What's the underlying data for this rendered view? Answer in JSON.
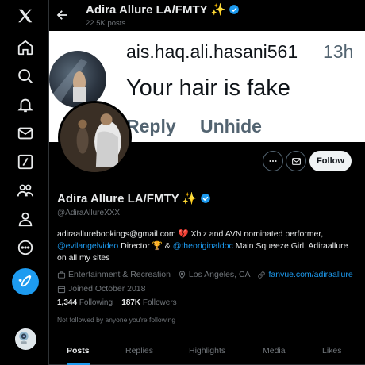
{
  "app": {
    "logo": "x-logo"
  },
  "nav": {
    "items": [
      {
        "name": "home",
        "icon": "home-icon"
      },
      {
        "name": "explore",
        "icon": "search-icon"
      },
      {
        "name": "notifications",
        "icon": "bell-icon"
      },
      {
        "name": "messages",
        "icon": "mail-icon"
      },
      {
        "name": "grok",
        "icon": "slash-box-icon"
      },
      {
        "name": "communities",
        "icon": "people-icon"
      },
      {
        "name": "profile",
        "icon": "person-icon"
      },
      {
        "name": "more",
        "icon": "more-circle-icon"
      }
    ],
    "compose_icon": "feather-plus-icon"
  },
  "header": {
    "name": "Adira Allure LA/FMTY",
    "emoji": "✨",
    "posts": "22.5K posts"
  },
  "banner": {
    "username": "ais.haq.ali.hasani561",
    "time": "13h",
    "text": "Your hair is fake",
    "reply": "Reply",
    "unhide": "Unhide"
  },
  "profile": {
    "name": "Adira Allure LA/FMTY",
    "emoji": "✨",
    "handle": "@AdiraAllureXXX",
    "bio_1": "adiraallurebookings@gmail.com",
    "bio_heart": "💔",
    "bio_2": " Xbiz and AVN nominated performer,",
    "bio_link1": "@evilangelvideo",
    "bio_3": " Director ",
    "bio_trophy": "🏆",
    "bio_4": " & ",
    "bio_link2": "@theoriginaldoc",
    "bio_5": " Main Squeeze Girl. Adiraallure on all my sites",
    "category": "Entertainment & Recreation",
    "location": "Los Angeles, CA",
    "website": "fanvue.com/adiraallure",
    "joined": "Joined October 2018",
    "following_count": "1,344",
    "following_label": "Following",
    "followers_count": "187K",
    "followers_label": "Followers",
    "not_followed": "Not followed by anyone you're following"
  },
  "actions": {
    "follow": "Follow"
  },
  "tabs": [
    "Posts",
    "Replies",
    "Highlights",
    "Media",
    "Likes"
  ],
  "colors": {
    "accent": "#1d9bf0",
    "verified": "#1d9bf0",
    "background": "#000000"
  }
}
